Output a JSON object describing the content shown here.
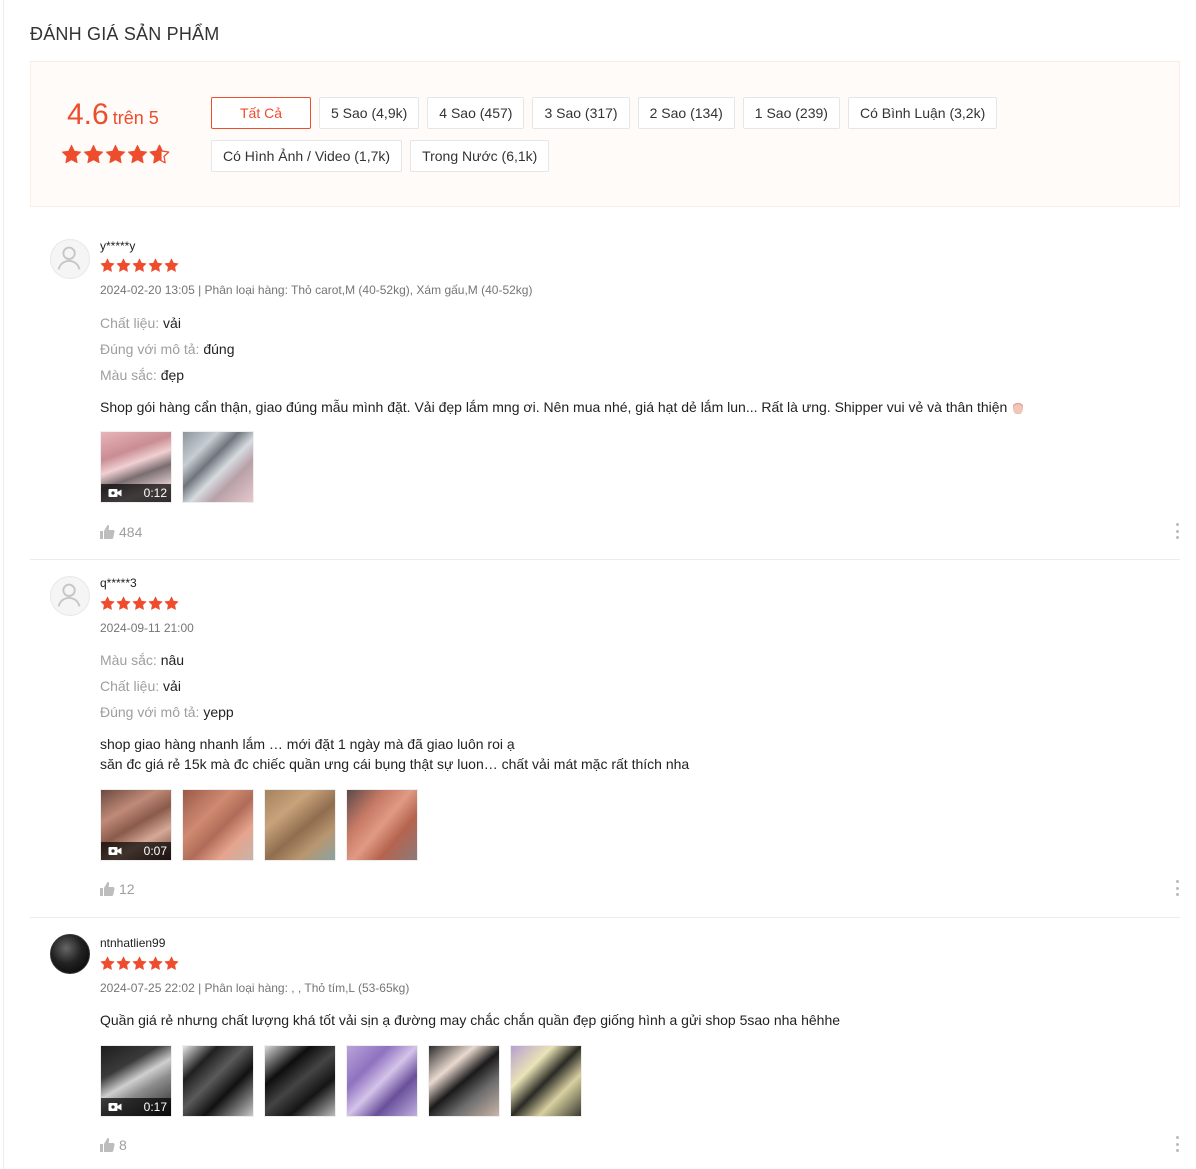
{
  "section_title": "ĐÁNH GIÁ SẢN PHẨM",
  "summary": {
    "score": "4.6",
    "score_suffix": "trên 5",
    "stars_rating": 4.6,
    "filters": [
      {
        "label": "Tất Cả",
        "active": true
      },
      {
        "label": "5 Sao (4,9k)"
      },
      {
        "label": "4 Sao (457)"
      },
      {
        "label": "3 Sao (317)"
      },
      {
        "label": "2 Sao (134)"
      },
      {
        "label": "1 Sao (239)"
      },
      {
        "label": "Có Bình Luận (3,2k)"
      },
      {
        "label": "Có Hình Ảnh / Video (1,7k)"
      },
      {
        "label": "Trong Nước (6,1k)"
      }
    ]
  },
  "colors": {
    "accent": "#ee4d2d",
    "muted": "#9e9e9e",
    "summary_bg": "#fffbf8"
  },
  "reviews": [
    {
      "username": "y*****y",
      "rating": 5,
      "meta": "2024-02-20 13:05 | Phân loại hàng: Thỏ carot,M (40-52kg), Xám gấu,M (40-52kg)",
      "attributes": [
        {
          "key": "Chất liệu:",
          "value": "vải"
        },
        {
          "key": "Đúng với mô tả:",
          "value": "đúng"
        },
        {
          "key": "Màu sắc:",
          "value": "đẹp"
        }
      ],
      "body": [
        "Shop gói hàng cẩn thận, giao đúng mẫu mình đặt. Vải đẹp lắm mng ơi. Nên mua nhé, giá hạt dẻ lắm lun... Rất là ưng. Shipper vui vẻ và thân thiện"
      ],
      "video_duration": "0:12",
      "likes": "484"
    },
    {
      "username": "q*****3",
      "rating": 5,
      "meta": "2024-09-11 21:00",
      "attributes": [
        {
          "key": "Màu sắc:",
          "value": "nâu"
        },
        {
          "key": "Chất liệu:",
          "value": "vải"
        },
        {
          "key": "Đúng với mô tả:",
          "value": "yepp"
        }
      ],
      "body": [
        "shop giao hàng nhanh lắm … mới đặt 1 ngày mà đã giao luôn roi ạ",
        "săn đc giá rẻ 15k mà đc chiếc quần ưng cái bụng thật sự luon… chất vải mát mặc rất thích nha"
      ],
      "video_duration": "0:07",
      "likes": "12"
    },
    {
      "username": "ntnhatlien99",
      "rating": 5,
      "meta": "2024-07-25 22:02 | Phân loại hàng: , , Thỏ tím,L (53-65kg)",
      "attributes": [],
      "body": [
        "Quần giá rẻ nhưng chất lượng khá tốt vải sịn ạ đường may chắc chắn quần đẹp giống hình a gửi shop 5sao nha hêhhe"
      ],
      "video_duration": "0:17",
      "likes": "8"
    }
  ]
}
